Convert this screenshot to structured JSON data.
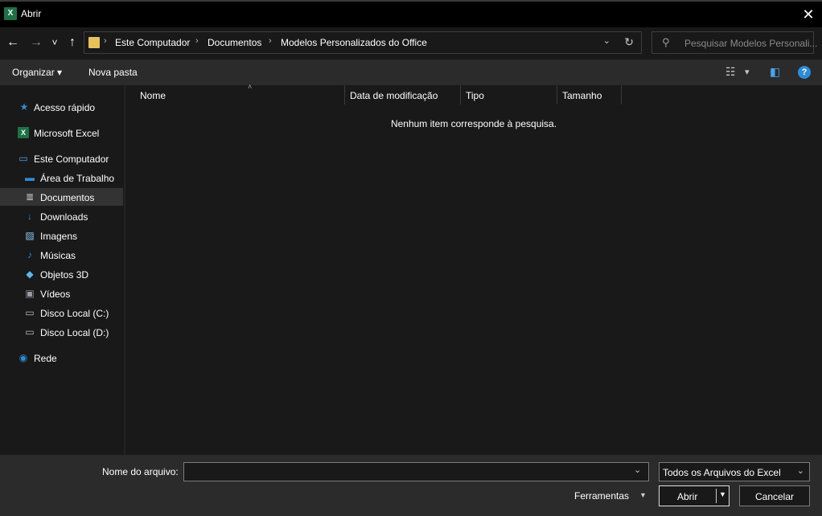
{
  "window": {
    "title": "Abrir",
    "app_icon_letter": "X",
    "close_glyph": "✕"
  },
  "nav": {
    "back_glyph": "←",
    "forward_glyph": "→",
    "recent_glyph": "˅",
    "up_glyph": "↑",
    "breadcrumb": [
      "Este Computador",
      "Documentos",
      "Modelos Personalizados do Office"
    ],
    "crumb_separator": "›",
    "address_dropdown_glyph": "⌄",
    "refresh_glyph": "↻",
    "search_placeholder": "Pesquisar Modelos Personali...",
    "search_glyph": "⚲"
  },
  "toolbar": {
    "organize_label": "Organizar ▾",
    "new_folder_label": "Nova pasta",
    "view_glyph": "☷",
    "view_dd_glyph": "▾",
    "preview_glyph": "◧",
    "help_glyph": "?"
  },
  "sidebar": {
    "items": [
      {
        "label": "Acesso rápido",
        "icon": "star-icon",
        "glyph": "★",
        "color": "#2b8dd8"
      },
      {
        "label": "Microsoft Excel",
        "icon": "excel-icon",
        "glyph": "X",
        "color": "#1e7145"
      },
      {
        "label": "Este Computador",
        "icon": "computer-icon",
        "glyph": "▭",
        "color": "#4aa3e8"
      },
      {
        "label": "Área de Trabalho",
        "icon": "desktop-icon",
        "glyph": "▬",
        "color": "#2b8dd8"
      },
      {
        "label": "Documentos",
        "icon": "document-icon",
        "glyph": "≣",
        "color": "#d8d8d8"
      },
      {
        "label": "Downloads",
        "icon": "download-icon",
        "glyph": "↓",
        "color": "#2b8dd8"
      },
      {
        "label": "Imagens",
        "icon": "image-icon",
        "glyph": "▨",
        "color": "#8ec7f0"
      },
      {
        "label": "Músicas",
        "icon": "music-icon",
        "glyph": "♪",
        "color": "#2b8dd8"
      },
      {
        "label": "Objetos 3D",
        "icon": "cube-icon",
        "glyph": "◆",
        "color": "#5fb7e8"
      },
      {
        "label": "Vídeos",
        "icon": "video-icon",
        "glyph": "▣",
        "color": "#9a9aa8"
      },
      {
        "label": "Disco Local (C:)",
        "icon": "drive-c-icon",
        "glyph": "▭",
        "color": "#bbbbbb"
      },
      {
        "label": "Disco Local (D:)",
        "icon": "drive-d-icon",
        "glyph": "▭",
        "color": "#bbbbbb"
      },
      {
        "label": "Rede",
        "icon": "network-icon",
        "glyph": "◉",
        "color": "#2b8dd8"
      }
    ],
    "selected_index": 4
  },
  "columns": {
    "name": "Nome",
    "sort_glyph": "˄",
    "modified": "Data de modificação",
    "type": "Tipo",
    "size": "Tamanho"
  },
  "content": {
    "empty_message": "Nenhum item corresponde à pesquisa."
  },
  "footer": {
    "filename_label": "Nome do arquivo:",
    "filename_value": "",
    "filename_dropdown_glyph": "⌄",
    "filter_value": "Todos os Arquivos do Excel",
    "filter_dropdown_glyph": "⌄",
    "tools_label": "Ferramentas",
    "tools_dropdown_glyph": "▼",
    "open_label": "Abrir",
    "open_dropdown_glyph": "▼",
    "cancel_label": "Cancelar"
  }
}
